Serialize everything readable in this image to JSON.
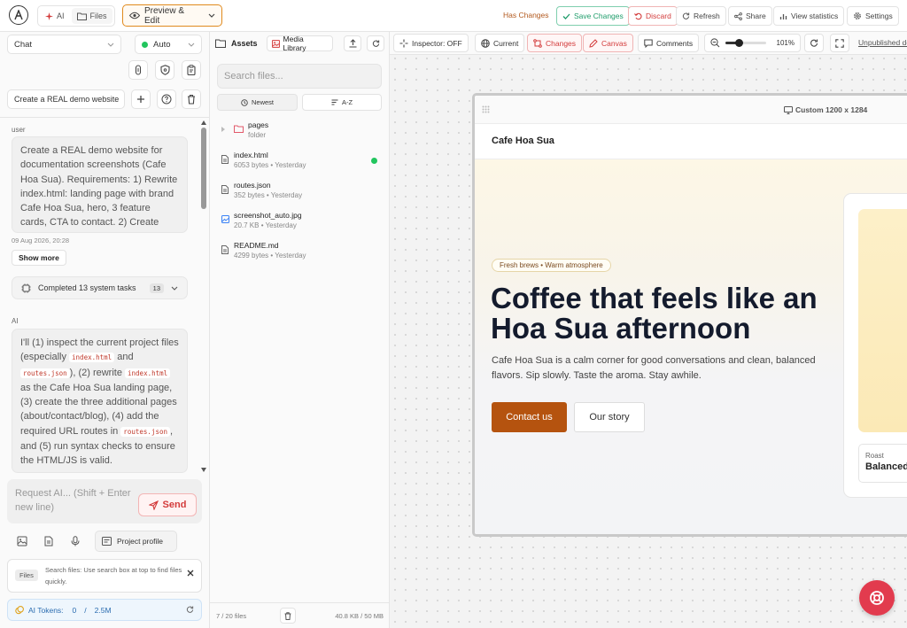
{
  "topbar": {
    "tabs": [
      {
        "label": "AI"
      },
      {
        "label": "Files"
      }
    ],
    "mode_label": "Preview & Edit",
    "status": "Has Changes",
    "save_label": "Save Changes",
    "discard_label": "Discard",
    "refresh_label": "Refresh",
    "share_label": "Share",
    "stats_label": "View statistics",
    "settings_label": "Settings"
  },
  "left": {
    "chat_select": "Chat",
    "model_select": "Auto",
    "session_title": "Create a REAL demo website",
    "user_role": "user",
    "user_message": "Create a REAL demo website for documentation screenshots (Cafe Hoa Sua). Requirements: 1) Rewrite index.html: landing page with brand Cafe Hoa Sua, hero, 3 feature cards, CTA to contact. 2) Create",
    "user_time": "09 Aug 2026, 20:28",
    "show_more": "Show more",
    "tasks_label": "Completed 13 system tasks",
    "tasks_count": "13",
    "ai_role": "AI",
    "ai_parts": [
      "I'll (1) inspect the current project files (especially ",
      "index.html",
      " and ",
      "routes.json",
      "), (2) rewrite ",
      "index.html",
      " as the Cafe Hoa Sua landing page, (3) create the three additional pages (about/contact/blog), (4) add the required URL routes in ",
      "routes.json",
      ", and (5) run syntax checks to ensure the HTML/JS is valid."
    ],
    "input_placeholder": "Request AI... (Shift + Enter new line)",
    "send_label": "Send",
    "project_profile": "Project profile",
    "hint_tag": "Files",
    "hint_text": "Search files: Use search box at top to find files quickly.",
    "tokens_label": "AI Tokens:",
    "tokens_used": "0",
    "tokens_sep": "/",
    "tokens_total": "2.5M"
  },
  "assets": {
    "title": "Assets",
    "media_label": "Media Library",
    "search_placeholder": "Search files...",
    "sort_newest": "Newest",
    "sort_az": "A-Z",
    "folder": {
      "name": "pages",
      "meta": "folder"
    },
    "files": [
      {
        "name": "index.html",
        "meta": "6053 bytes • Yesterday",
        "active": true
      },
      {
        "name": "routes.json",
        "meta": "352 bytes • Yesterday",
        "active": false
      },
      {
        "name": "screenshot_auto.jpg",
        "meta": "20.7 KB • Yesterday",
        "active": false
      },
      {
        "name": "README.md",
        "meta": "4299 bytes • Yesterday",
        "active": false
      }
    ],
    "footer_count": "7 / 20 files",
    "footer_size": "40.8 KB / 50 MB"
  },
  "canvas_toolbar": {
    "inspector": "Inspector: OFF",
    "current": "Current",
    "changes": "Changes",
    "canvas": "Canvas",
    "comments": "Comments",
    "zoom": "101%",
    "unpublished": "Unpublished de"
  },
  "preview": {
    "size_label": "Custom 1200 x 1284",
    "brand": "Cafe Hoa Sua",
    "badge": "Fresh brews • Warm atmosphere",
    "headline_1": "Coffee that feels like an",
    "headline_2": "Hoa Sua afternoon",
    "subtext": "Cafe Hoa Sua is a calm corner for good conversations and clean, balanced flavors. Sip slowly. Taste the aroma. Stay awhile.",
    "cta_primary": "Contact us",
    "cta_secondary": "Our story",
    "card_label": "Roast",
    "card_value": "Balanced"
  },
  "colors": {
    "accent_orange": "#e08a1e",
    "cta_brown": "#b5530f",
    "save_green": "#1f9d6b",
    "discard_red": "#d33b3b",
    "fab_red": "#e23b4e"
  }
}
